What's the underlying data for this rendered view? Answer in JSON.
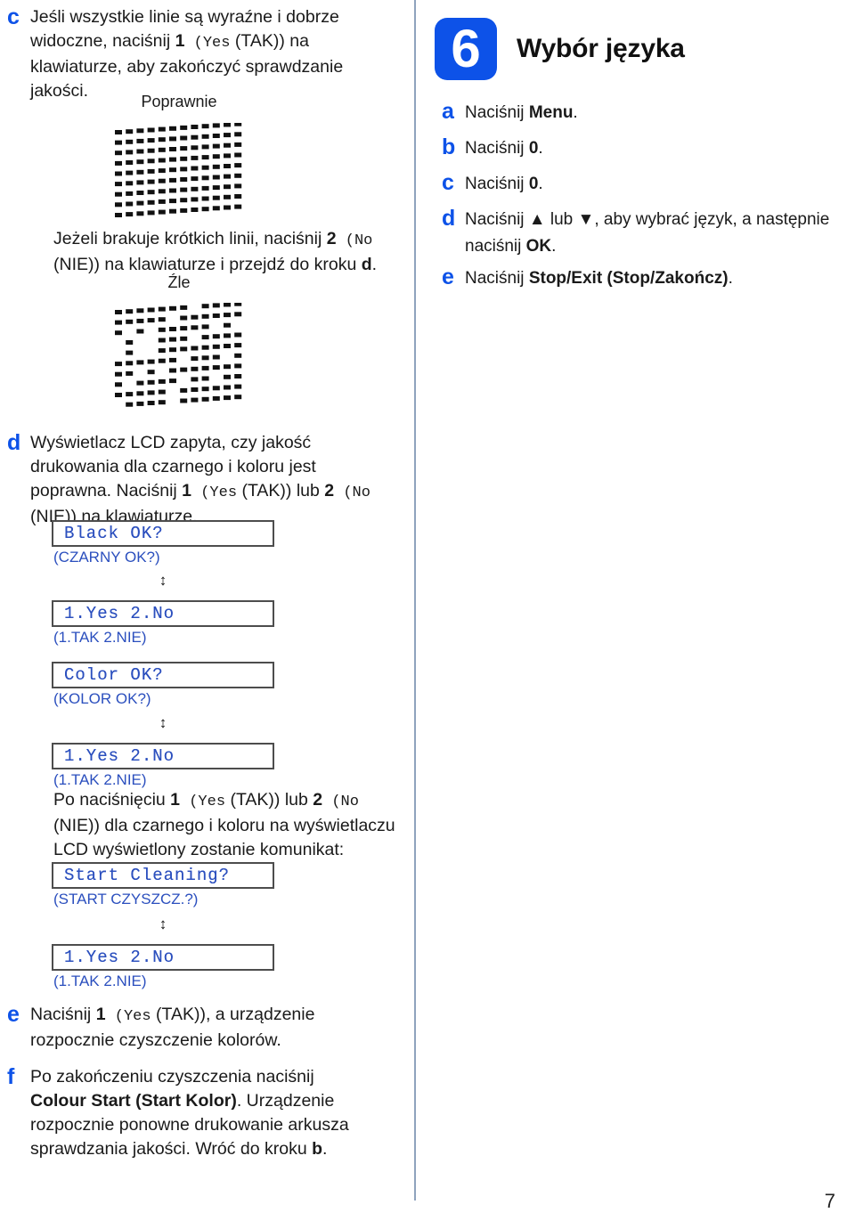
{
  "page": {
    "number": "7",
    "divider": true,
    "accent_color": "#0d52e8",
    "lcd_text_color": "#2b4fbe",
    "lcd_border_color": "#4d4d4d"
  },
  "left_column": {
    "step_c": {
      "letter": "c",
      "text_1": "Jeśli wszystkie linie są wyraźne i dobrze widoczne, naciśnij ",
      "bold_1": "1",
      "mono_1": " (Yes",
      "text_2": " (TAK)) na klawiaturze, aby zakończyć sprawdzanie jakości.",
      "good_caption": "Poprawnie",
      "text_3": "Jeżeli brakuje krótkich linii, naciśnij ",
      "bold_2": "2",
      "mono_2": " (No",
      "text_4": " (NIE)) na klawiaturze i przejdź do kroku ",
      "bold_3": "d",
      "text_5": ".",
      "bad_caption": "Źle"
    },
    "step_d": {
      "letter": "d",
      "text_1": "Wyświetlacz LCD zapyta, czy jakość drukowania dla czarnego i koloru jest poprawna. Naciśnij ",
      "bold_1": "1",
      "mono_1": " (Yes",
      "text_2": " (TAK)) lub ",
      "bold_2": "2",
      "mono_2": " (No",
      "text_3": " (NIE)) na klawiaturze.",
      "lcd_1": {
        "display": "Black OK?",
        "translation": "(CZARNY OK?)"
      },
      "arrow_1": "↕",
      "lcd_2": {
        "display": "1.Yes 2.No",
        "translation": "(1.TAK 2.NIE)"
      },
      "lcd_3": {
        "display": "Color OK?",
        "translation": "(KOLOR OK?)"
      },
      "arrow_2": "↕",
      "lcd_4": {
        "display": "1.Yes 2.No",
        "translation": "(1.TAK 2.NIE)"
      },
      "para_1": "Po naciśnięciu ",
      "para_bold_1": "1",
      "para_mono_1": " (Yes",
      "para_2": " (TAK)) lub ",
      "para_bold_2": "2",
      "para_mono_2": " (No",
      "para_3": " (NIE)) dla czarnego i koloru na wyświetlaczu LCD wyświetlony zostanie komunikat:",
      "lcd_5": {
        "display": "Start Cleaning?",
        "translation": "(START CZYSZCZ.?)"
      },
      "arrow_3": "↕",
      "lcd_6": {
        "display": "1.Yes 2.No",
        "translation": "(1.TAK 2.NIE)"
      }
    },
    "step_e": {
      "letter": "e",
      "text_1": "Naciśnij ",
      "bold_1": "1",
      "mono_1": " (Yes",
      "text_2": " (TAK)), a urządzenie rozpocznie czyszczenie kolorów."
    },
    "step_f": {
      "letter": "f",
      "text_1": "Po zakończeniu czyszczenia naciśnij ",
      "bold_1": "Colour Start (Start Kolor)",
      "text_2": ". Urządzenie rozpocznie ponowne drukowanie arkusza sprawdzania jakości. Wróć do kroku ",
      "bold_2": "b",
      "text_3": "."
    }
  },
  "right_column": {
    "header": {
      "step_number": "6",
      "title": "Wybór języka"
    },
    "steps": [
      {
        "letter": "a",
        "text_1": "Naciśnij ",
        "bold_1": "Menu",
        "text_2": "."
      },
      {
        "letter": "b",
        "text_1": "Naciśnij ",
        "bold_1": "0",
        "text_2": "."
      },
      {
        "letter": "c",
        "text_1": "Naciśnij ",
        "bold_1": "0",
        "text_2": "."
      },
      {
        "letter": "d",
        "text_1": "Naciśnij ▲ lub ▼, aby wybrać język, a następnie naciśnij ",
        "bold_1": "OK",
        "text_2": "."
      },
      {
        "letter": "e",
        "text_1": "Naciśnij ",
        "bold_1": "Stop/Exit (Stop/Zakończ)",
        "text_2": "."
      }
    ]
  }
}
